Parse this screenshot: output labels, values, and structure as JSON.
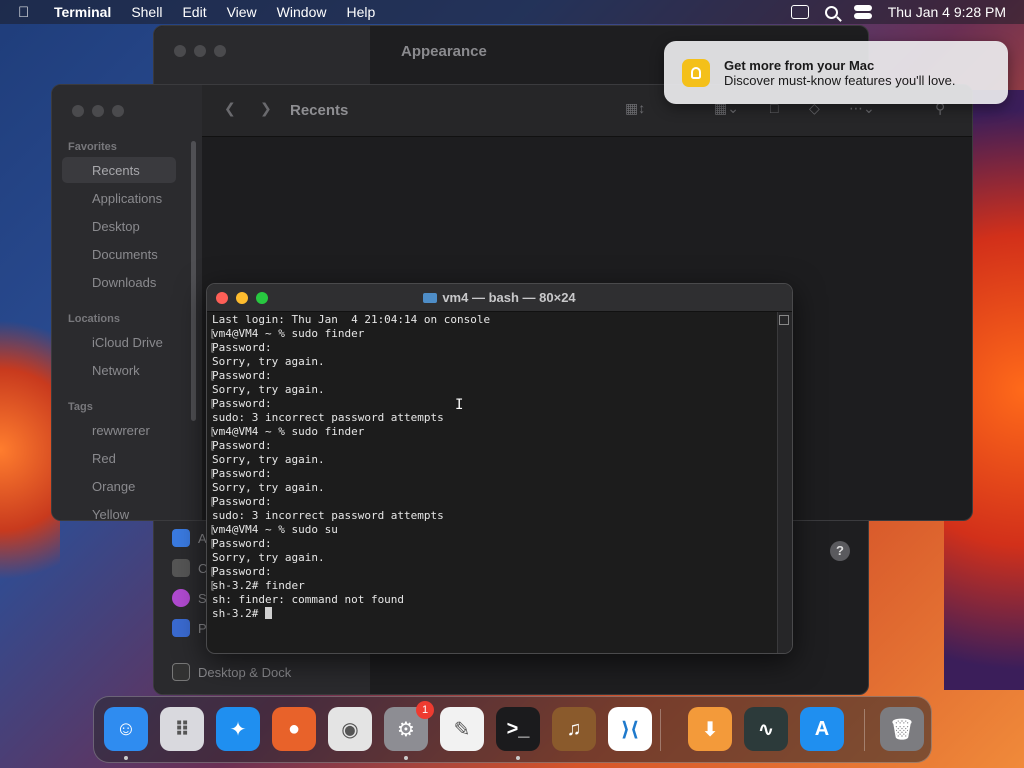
{
  "menubar": {
    "app_name": "Terminal",
    "menus": [
      "Shell",
      "Edit",
      "View",
      "Window",
      "Help"
    ],
    "clock": "Thu Jan 4  9:28 PM"
  },
  "settings": {
    "title": "Appearance",
    "items": [
      {
        "label": "A",
        "icon": "info-icon"
      },
      {
        "label": "C",
        "icon": "gear-icon"
      },
      {
        "label": "S",
        "icon": "siri-icon"
      },
      {
        "label": "P",
        "icon": "hand-icon"
      },
      {
        "label": "Desktop & Dock",
        "icon": "dock-icon"
      }
    ],
    "help": "?"
  },
  "finder": {
    "title": "Recents",
    "favorites_label": "Favorites",
    "favorites": [
      "Recents",
      "Applications",
      "Desktop",
      "Documents",
      "Downloads"
    ],
    "locations_label": "Locations",
    "locations": [
      "iCloud Drive",
      "Network"
    ],
    "tags_label": "Tags",
    "tags": [
      "rewwrerer",
      "Red",
      "Orange",
      "Yellow"
    ]
  },
  "notification": {
    "title": "Get more from your Mac",
    "body": "Discover must-know features you'll love."
  },
  "terminal": {
    "title": "vm4 — bash — 80×24",
    "lines": [
      {
        "text": "Last login: Thu Jan  4 21:04:14 on console",
        "mark": false
      },
      {
        "text": "vm4@VM4 ~ % sudo finder",
        "mark": true
      },
      {
        "text": "Password:",
        "mark": true
      },
      {
        "text": "Sorry, try again.",
        "mark": false
      },
      {
        "text": "Password:",
        "mark": true
      },
      {
        "text": "Sorry, try again.",
        "mark": false
      },
      {
        "text": "Password:",
        "mark": true
      },
      {
        "text": "sudo: 3 incorrect password attempts",
        "mark": false
      },
      {
        "text": "vm4@VM4 ~ % sudo finder",
        "mark": true
      },
      {
        "text": "Password:",
        "mark": true
      },
      {
        "text": "Sorry, try again.",
        "mark": false
      },
      {
        "text": "Password:",
        "mark": true
      },
      {
        "text": "Sorry, try again.",
        "mark": false
      },
      {
        "text": "Password:",
        "mark": true
      },
      {
        "text": "sudo: 3 incorrect password attempts",
        "mark": false
      },
      {
        "text": "vm4@VM4 ~ % sudo su",
        "mark": true
      },
      {
        "text": "Password:",
        "mark": true
      },
      {
        "text": "Sorry, try again.",
        "mark": false
      },
      {
        "text": "Password:",
        "mark": true
      },
      {
        "text": "sh-3.2# finder",
        "mark": true
      },
      {
        "text": "sh: finder: command not found",
        "mark": false
      },
      {
        "text": "sh-3.2# ",
        "mark": false
      }
    ]
  },
  "dock": {
    "apps": [
      {
        "name": "finder",
        "glyph": "☺",
        "color": "#2f8cf0",
        "running": true
      },
      {
        "name": "launchpad",
        "glyph": "⠿",
        "color": "#d9d9de",
        "running": false
      },
      {
        "name": "safari",
        "glyph": "✦",
        "color": "#1f8ff0",
        "running": false
      },
      {
        "name": "firefox",
        "glyph": "●",
        "color": "#e8622a",
        "running": false
      },
      {
        "name": "chrome",
        "glyph": "◉",
        "color": "#e4e4e4",
        "running": false
      },
      {
        "name": "system-settings",
        "glyph": "⚙",
        "color": "#8d8d93",
        "running": true,
        "badge": "1"
      },
      {
        "name": "textedit",
        "glyph": "✎",
        "color": "#f2f2f2",
        "running": false
      },
      {
        "name": "terminal",
        "glyph": ">_",
        "color": "#1b1b1d",
        "running": true
      },
      {
        "name": "garageband",
        "glyph": "♫",
        "color": "#8a5a2c",
        "running": false
      },
      {
        "name": "vscode",
        "glyph": "⟩⟨",
        "color": "#ffffff",
        "running": false
      },
      {
        "name": "downloads-stack",
        "glyph": "⬇",
        "color": "#f39a3a",
        "running": false
      },
      {
        "name": "activity-monitor",
        "glyph": "∿",
        "color": "#2c3a3a",
        "running": false
      },
      {
        "name": "app-store",
        "glyph": "A",
        "color": "#1f8ff0",
        "running": false
      },
      {
        "name": "trash",
        "glyph": "🗑",
        "color": "#7c7c80",
        "running": false
      }
    ]
  }
}
